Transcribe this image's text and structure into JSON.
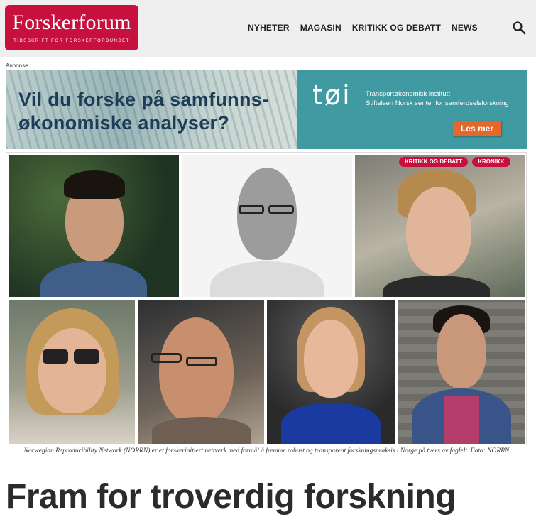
{
  "header": {
    "logo_name": "Forskerforum",
    "logo_tagline": "TIDSSKRIFT FOR FORSKERFORBUNDET",
    "nav": [
      "NYHETER",
      "MAGASIN",
      "KRITIKK OG DEBATT",
      "NEWS"
    ],
    "search_icon": "search-icon"
  },
  "ad": {
    "label": "Annonse",
    "headline_line1": "Vil du forske på samfunns-",
    "headline_line2": "økonomiske analyser?",
    "brand_logo": "tøi",
    "brand_line1": "Transportøkonomisk institutt",
    "brand_line2": "Stiftelsen Norsk senter for samferdselsforskning",
    "cta": "Les mer",
    "colors": {
      "teal": "#3f9aa1",
      "orange": "#e4672c"
    }
  },
  "article": {
    "tags": [
      "KRITIKK OG DEBATT",
      "KRONIKK"
    ],
    "caption": "Norwegian Reproducibility Network (NORRN) er et forskerinitiert nettverk med formål å fremme robust og transparent forskningspraksis i Norge på tvers av fagfelt. Foto: NORRN",
    "title": "Fram for troverdig forskning"
  },
  "colors": {
    "brand": "#c8103e"
  }
}
